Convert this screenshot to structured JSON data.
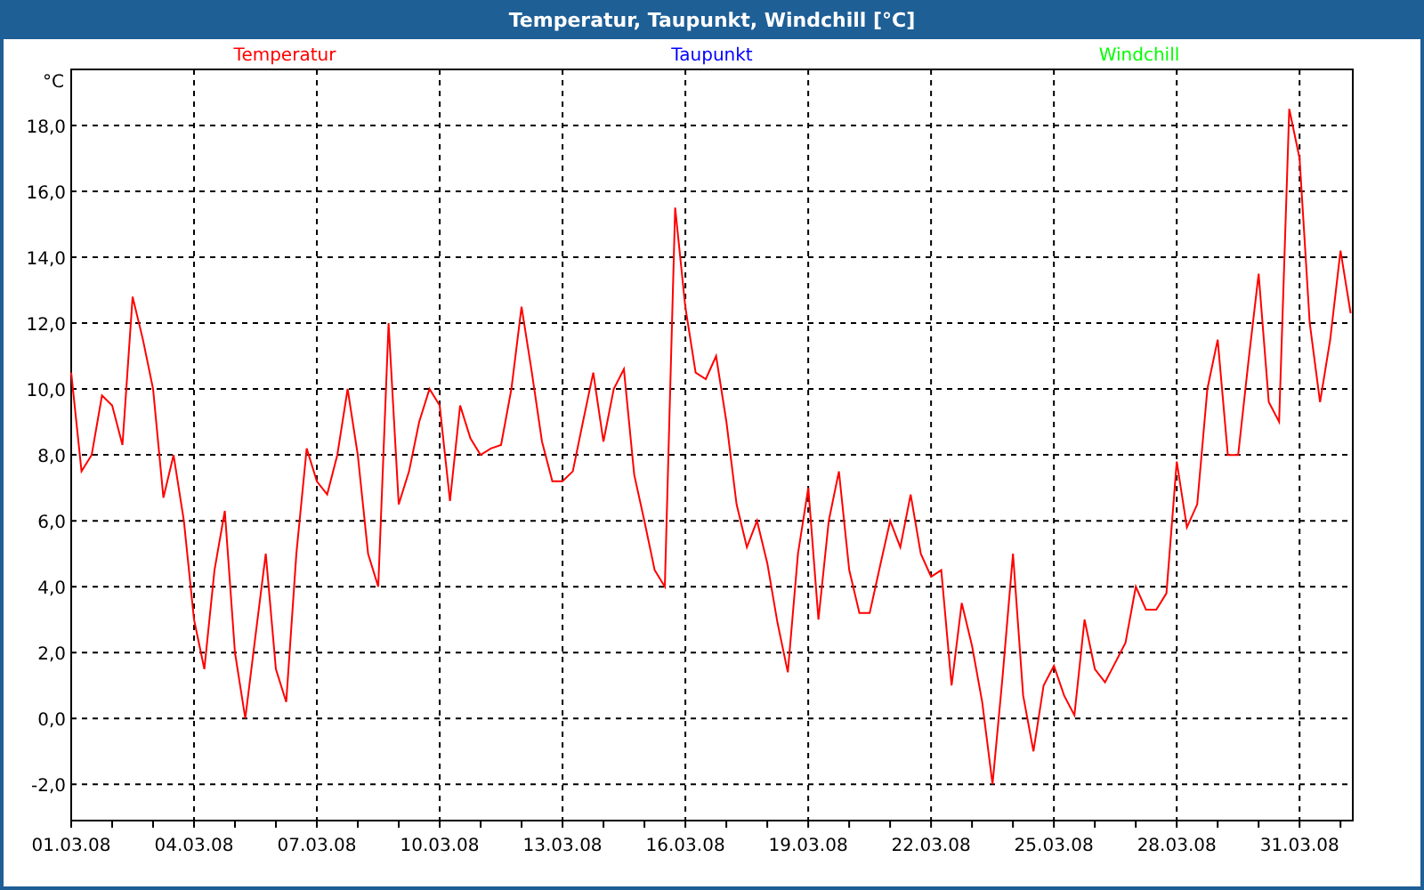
{
  "window": {
    "title": "Temperatur, Taupunkt, Windchill [°C]"
  },
  "legend": [
    {
      "name": "Taupunkt",
      "color": "#0000ff"
    },
    {
      "name": "Windchill",
      "color": "#00ff00"
    }
  ],
  "chart_data": {
    "type": "line",
    "grid": true,
    "ylabel": "°C",
    "ylim": [
      -3.1,
      19.7
    ],
    "categories": [
      "01.03.08",
      null,
      null,
      null,
      null,
      null,
      null,
      null,
      null,
      null,
      null,
      null,
      "04.03.08",
      null,
      null,
      null,
      null,
      null,
      null,
      null,
      null,
      null,
      null,
      null,
      "07.03.08",
      null,
      null,
      null,
      null,
      null,
      null,
      null,
      null,
      null,
      null,
      null,
      "10.03.08",
      null,
      null,
      null,
      null,
      null,
      null,
      null,
      null,
      null,
      null,
      null,
      "13.03.08",
      null,
      null,
      null,
      null,
      null,
      null,
      null,
      null,
      null,
      null,
      null,
      "16.03.08",
      null,
      null,
      null,
      null,
      null,
      null,
      null,
      null,
      null,
      null,
      null,
      "19.03.08",
      null,
      null,
      null,
      null,
      null,
      null,
      null,
      null,
      null,
      null,
      null,
      "22.03.08",
      null,
      null,
      null,
      null,
      null,
      null,
      null,
      null,
      null,
      null,
      null,
      "25.03.08",
      null,
      null,
      null,
      null,
      null,
      null,
      null,
      null,
      null,
      null,
      null,
      "28.03.08",
      null,
      null,
      null,
      null,
      null,
      null,
      null,
      null,
      null,
      null,
      null,
      "31.03.08",
      null,
      null,
      null,
      null,
      null
    ],
    "yticks": [
      {
        "value": -2,
        "label": "-2,0"
      },
      {
        "value": 0,
        "label": "0,0"
      },
      {
        "value": 2,
        "label": "2,0"
      },
      {
        "value": 4,
        "label": "4,0"
      },
      {
        "value": 6,
        "label": "6,0"
      },
      {
        "value": 8,
        "label": "8,0"
      },
      {
        "value": 10,
        "label": "10,0"
      },
      {
        "value": 12,
        "label": "12,0"
      },
      {
        "value": 14,
        "label": "14,0"
      },
      {
        "value": 16,
        "label": "16,0"
      },
      {
        "value": 18,
        "label": "18,0"
      }
    ],
    "series": [
      {
        "name": "Temperatur",
        "color": "#ff0000",
        "values": [
          10.5,
          7.5,
          8,
          9.8,
          9.5,
          8.3,
          12.8,
          11.5,
          10,
          6.7,
          8,
          6,
          3,
          1.5,
          4.5,
          6.3,
          2,
          0,
          2.5,
          5,
          1.5,
          0.5,
          5,
          8.2,
          7.2,
          6.8,
          8,
          10,
          8,
          5,
          4,
          12,
          6.5,
          7.5,
          9,
          10,
          9.5,
          6.6,
          9.5,
          8.5,
          8,
          8.2,
          8.3,
          10,
          12.5,
          10.5,
          8.4,
          7.2,
          7.2,
          7.5,
          9,
          10.5,
          8.4,
          10,
          10.6,
          7.4,
          6,
          4.5,
          4,
          15.5,
          12.5,
          10.5,
          10.3,
          11,
          9,
          6.5,
          5.2,
          6,
          4.7,
          2.9,
          1.4,
          5,
          7,
          3,
          6,
          7.5,
          4.5,
          3.2,
          3.2,
          4.6,
          6,
          5.2,
          6.8,
          5,
          4.3,
          4.5,
          1,
          3.5,
          2.2,
          0.5,
          -2,
          1.3,
          5,
          0.7,
          -1,
          1,
          1.6,
          0.7,
          0.1,
          3,
          1.5,
          1.1,
          1.7,
          2.3,
          4,
          3.3,
          3.3,
          3.8,
          7.8,
          5.8,
          6.5,
          10,
          11.5,
          8,
          8,
          10.8,
          13.5,
          9.6,
          9,
          18.5,
          17,
          12,
          9.6,
          11.5,
          14.2,
          12.3
        ]
      }
    ]
  }
}
